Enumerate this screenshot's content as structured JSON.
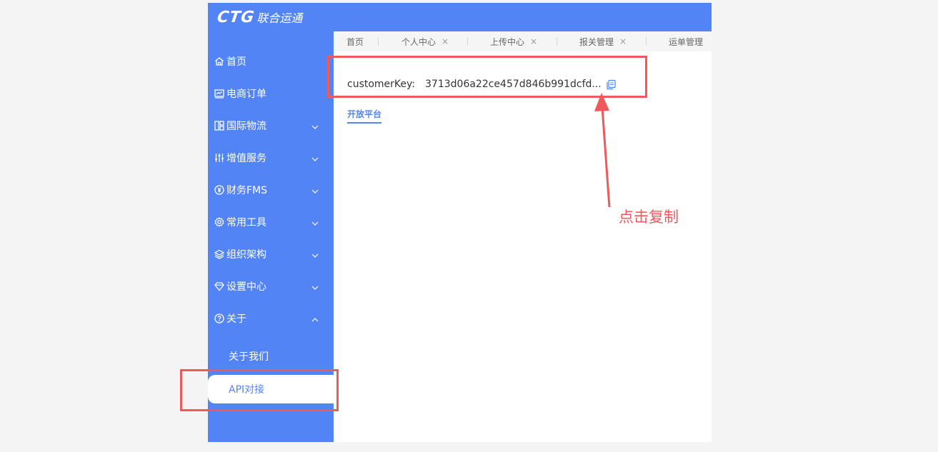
{
  "brand": {
    "mark": "CTG",
    "name": "联合运通"
  },
  "sidebar": {
    "items": [
      {
        "label": "首页",
        "icon": "home-icon"
      },
      {
        "label": "电商订单",
        "icon": "monitor-chart-icon"
      },
      {
        "label": "国际物流",
        "icon": "grid-icon"
      },
      {
        "label": "增值服务",
        "icon": "sliders-icon"
      },
      {
        "label": "财务FMS",
        "icon": "yen-coin-icon"
      },
      {
        "label": "常用工具",
        "icon": "gear-icon"
      },
      {
        "label": "组织架构",
        "icon": "layers-icon"
      },
      {
        "label": "设置中心",
        "icon": "diamond-icon"
      },
      {
        "label": "关于",
        "icon": "question-circle-icon"
      }
    ],
    "sub_items": [
      {
        "label": "关于我们"
      },
      {
        "label": "API对接"
      }
    ]
  },
  "tabs": [
    {
      "label": "首页"
    },
    {
      "label": "个人中心",
      "close": "×"
    },
    {
      "label": "上传中心",
      "close": "×"
    },
    {
      "label": "报关管理",
      "close": "×"
    },
    {
      "label": "运单管理"
    }
  ],
  "content": {
    "key_label": "customerKey:",
    "key_value": "3713d06a22ce457d846b991dcfd...",
    "open_platform_link": "开放平台"
  },
  "annotation": {
    "text": "点击复制",
    "color": "#f0595a"
  },
  "colors": {
    "primary": "#5384f6",
    "annotation": "#f0595a"
  }
}
